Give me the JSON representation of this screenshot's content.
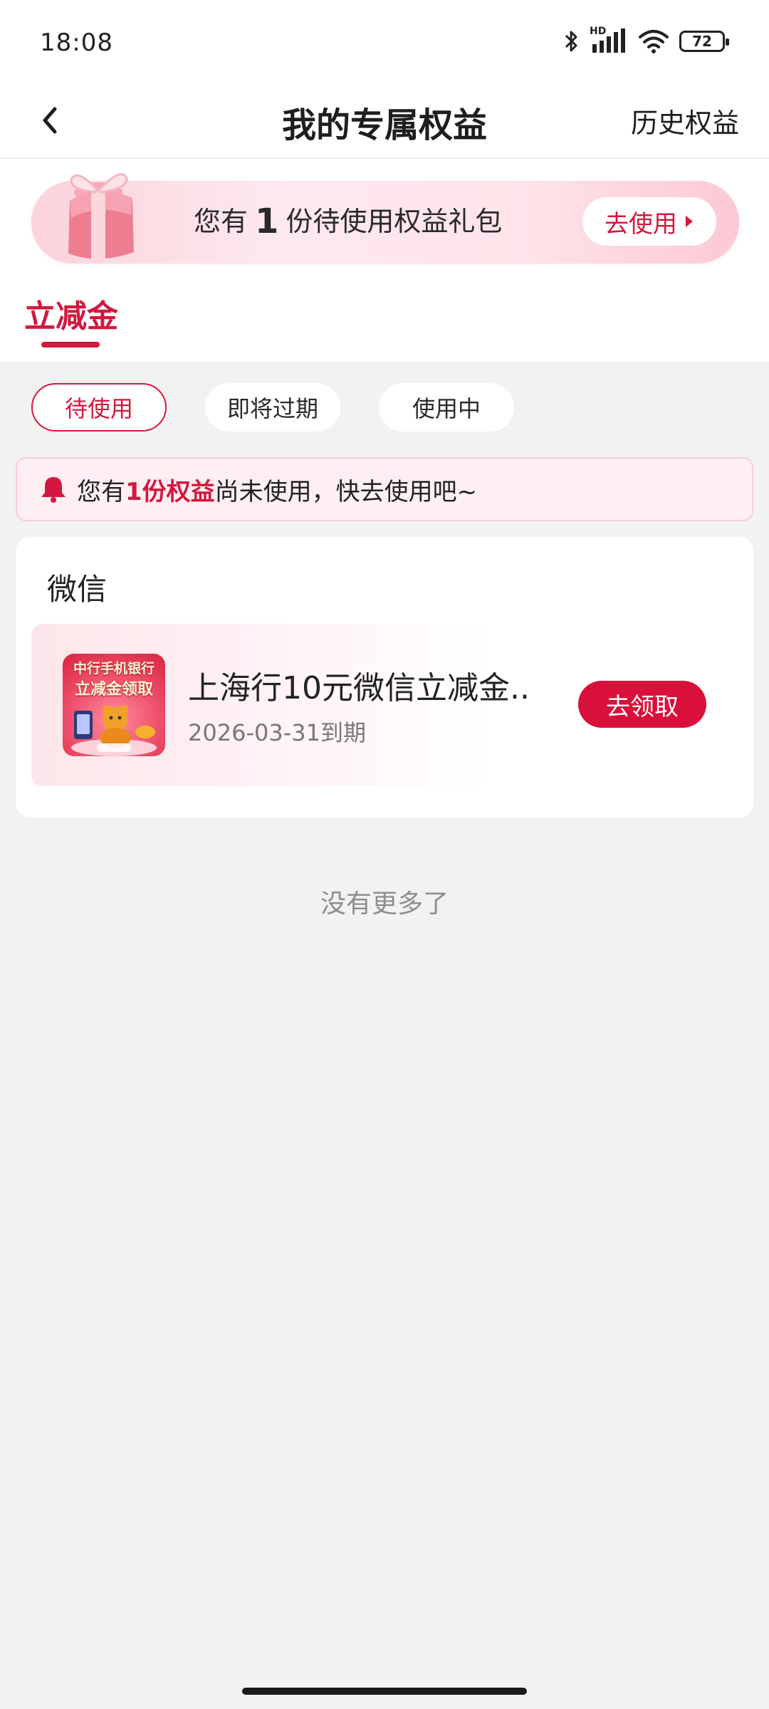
{
  "status_bar": {
    "time": "18:08",
    "battery": "72",
    "network_label": "HD"
  },
  "nav": {
    "title": "我的专属权益",
    "history": "历史权益"
  },
  "banner": {
    "prefix": "您有",
    "count": "1",
    "suffix": "份待使用权益礼包",
    "button": "去使用"
  },
  "tab": {
    "label": "立减金"
  },
  "filters": [
    {
      "label": "待使用",
      "active": true
    },
    {
      "label": "即将过期",
      "active": false
    },
    {
      "label": "使用中",
      "active": false
    }
  ],
  "notice": {
    "prefix": "您有",
    "highlight": "1份权益",
    "suffix": "尚未使用，快去使用吧~"
  },
  "card": {
    "title": "微信",
    "item": {
      "name": "上海行10元微信立减金...",
      "expiry": "2026-03-31到期",
      "button": "去领取",
      "thumb_line1": "中行手机银行",
      "thumb_line2": "立减金领取"
    }
  },
  "footer_text": "没有更多了",
  "colors": {
    "accent": "#d4173e",
    "background": "#f2f2f2"
  }
}
